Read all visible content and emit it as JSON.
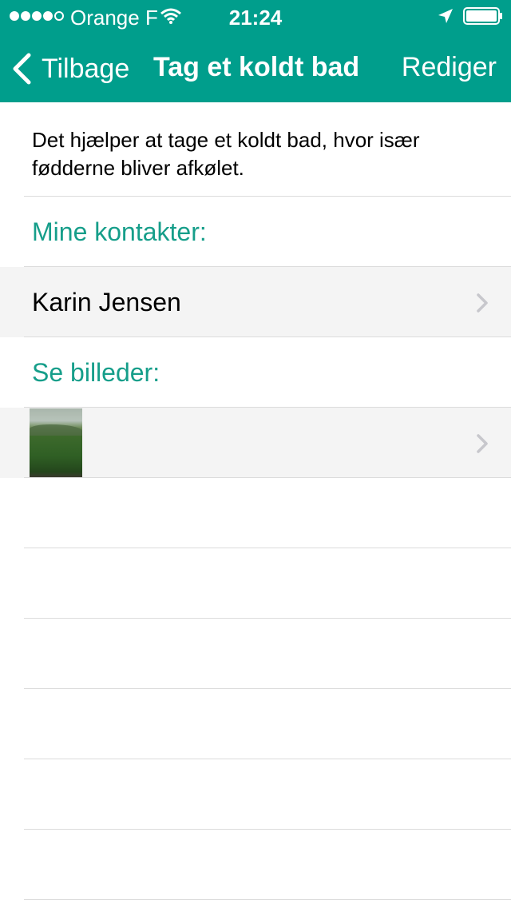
{
  "status_bar": {
    "carrier": "Orange F",
    "time": "21:24",
    "signal_bars_filled": 4,
    "signal_bars_total": 5
  },
  "nav": {
    "back_label": "Tilbage",
    "title": "Tag et koldt bad",
    "edit_label": "Rediger"
  },
  "description": "Det hjælper at tage et koldt bad, hvor især fødderne bliver afkølet.",
  "contacts": {
    "header": "Mine kontakter:",
    "items": [
      {
        "name": "Karin Jensen"
      }
    ]
  },
  "images": {
    "header": "Se billeder:"
  },
  "colors": {
    "accent": "#009e8c",
    "section_text": "#169e8a",
    "row_highlight": "#f4f4f4"
  }
}
